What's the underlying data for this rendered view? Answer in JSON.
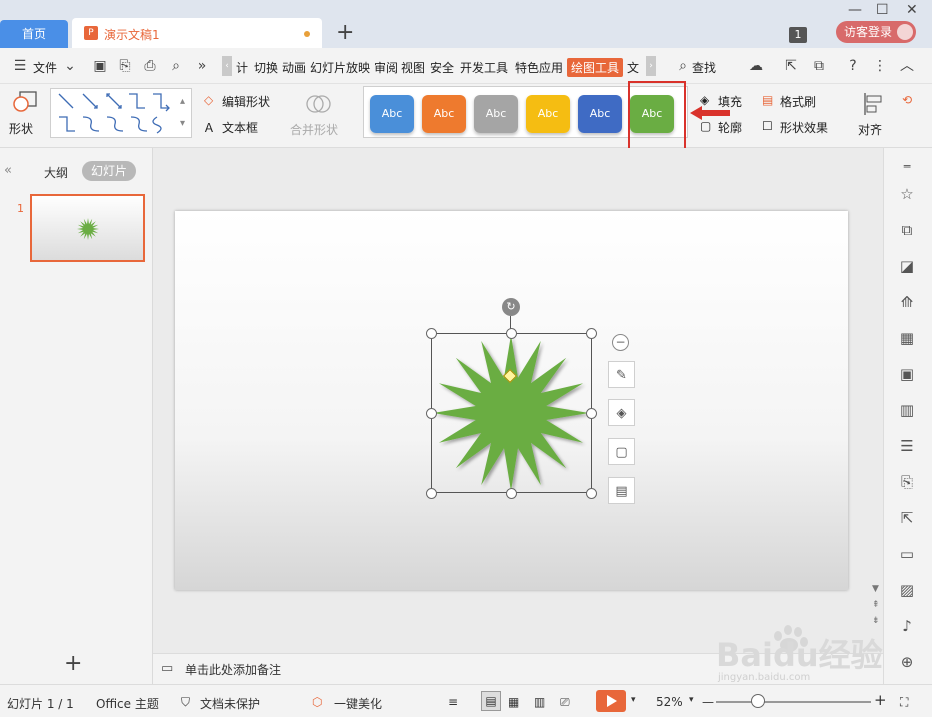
{
  "titlebar": {
    "home_tab": "首页",
    "doc_tab": "演示文稿1",
    "doc_icon": "P",
    "new_tab": "+",
    "window_count": "1",
    "login": "访客登录",
    "win_min": "—",
    "win_max": "☐",
    "win_close": "✕"
  },
  "menubar": {
    "file": "文件",
    "items": [
      "计",
      "切换",
      "动画",
      "幻灯片放映",
      "审阅",
      "视图",
      "安全",
      "开发工具",
      "特色应用",
      "绘图工具",
      "文"
    ],
    "search": "查找"
  },
  "ribbon": {
    "shape_label": "形状",
    "edit_shape": "编辑形状",
    "text_box": "文本框",
    "merge_shapes": "合并形状",
    "style_label": "Abc",
    "fill": "填充",
    "outline": "轮廓",
    "format_painter": "格式刷",
    "shape_effects": "形状效果",
    "align": "对齐"
  },
  "style_colors": [
    "#4a8fd9",
    "#ee7a2e",
    "#a5a5a5",
    "#f5bd12",
    "#3f6bc4",
    "#6aad43"
  ],
  "left_panel": {
    "outline_tab": "大纲",
    "slides_tab": "幻灯片",
    "slide_number": "1",
    "add": "+"
  },
  "notes": {
    "placeholder": "单击此处添加备注"
  },
  "statusbar": {
    "slide_info": "幻灯片 1 / 1",
    "theme": "Office 主题",
    "protection": "文档未保护",
    "beautify": "一键美化",
    "zoom": "52%",
    "zoom_minus": "—",
    "zoom_plus": "+"
  },
  "watermark": {
    "brand": "Baidu经验",
    "url": "jingyan.baidu.com"
  },
  "colors": {
    "accent": "#e8673a",
    "star_green": "#6aad43",
    "highlight_red": "#d9322b"
  }
}
